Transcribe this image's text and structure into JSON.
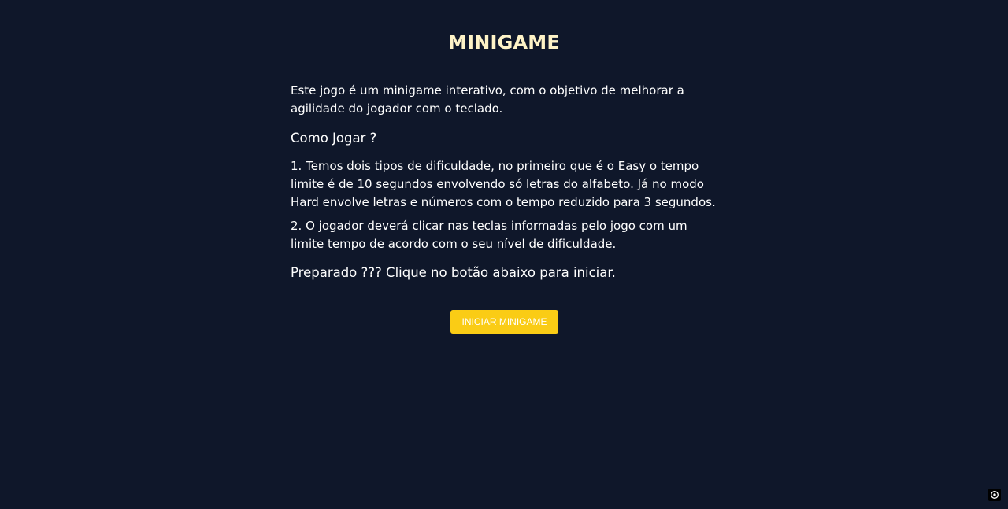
{
  "page": {
    "title": "MINIGAME",
    "background_color": "#0f172a",
    "title_color": "#fef3c7"
  },
  "content": {
    "intro": "Este jogo é um minigame interativo, com o objetivo de melhorar a agilidade do jogador com o teclado.",
    "how_to_play_heading": "Como Jogar ?",
    "rules": [
      "1. Temos dois tipos de dificuldade, no primeiro que é o Easy o tempo limite é de 10 segundos envolvendo só letras do alfabeto. Já no modo Hard envolve letras e números com o tempo reduzido para 3 segundos.",
      "2. O jogador deverá clicar nas teclas informadas pelo jogo com um limite tempo de acordo com o seu nível de dificuldade."
    ],
    "ready_text": "Preparado ??? Clique no botão abaixo para iniciar."
  },
  "start_button": {
    "label": "INICIAR MINIGAME",
    "color": "#facc15"
  },
  "corner_badge": {
    "icon": "target-icon"
  }
}
